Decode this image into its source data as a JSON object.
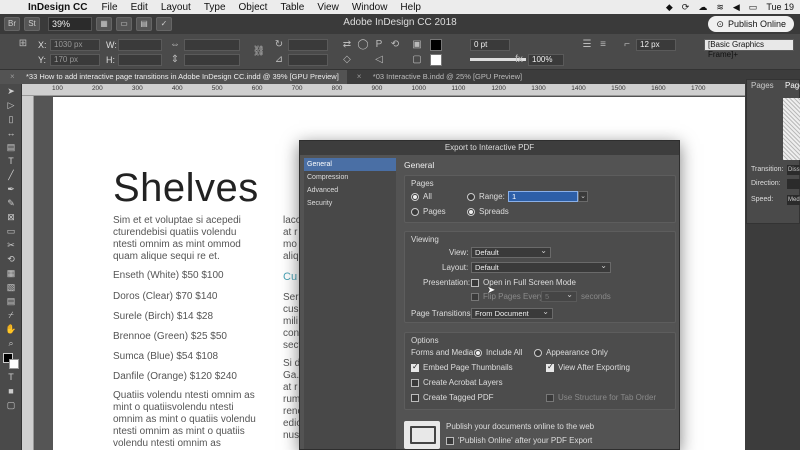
{
  "menubar": {
    "app": "InDesign CC",
    "menus": [
      "File",
      "Edit",
      "Layout",
      "Type",
      "Object",
      "Table",
      "View",
      "Window",
      "Help"
    ],
    "clock": "Tue 19"
  },
  "appbar": {
    "title": "Adobe InDesign CC 2018",
    "zoom": "39%",
    "br_label": "Br",
    "st_label": "St",
    "publish_label": "Publish Online"
  },
  "control": {
    "x_label": "X:",
    "y_label": "Y:",
    "w_label": "W:",
    "h_label": "H:",
    "x_value": "1030 px",
    "y_value": "170 px",
    "stroke_weight": "0 pt",
    "opacity": "100%",
    "size_value": "12 px",
    "style_value": "[Basic Graphics Frame]+"
  },
  "tabs": [
    {
      "label": "*33 How to add interactive page transitions in Adobe InDesign CC.indd @ 39% [GPU Preview]"
    },
    {
      "label": "*03 Interactive B.indd @ 25% [GPU Preview]"
    }
  ],
  "ruler": {
    "ticks": [
      "100",
      "200",
      "300",
      "400",
      "500",
      "600",
      "700",
      "800",
      "900",
      "1000",
      "1100",
      "1200",
      "1300",
      "1400",
      "1500",
      "1600",
      "1700"
    ]
  },
  "document": {
    "heading": "Shelves",
    "intro": "Sim et et voluptae si acepedi cturendebisi quatiis volendu ntesti omnim as mint ommod quam alique sequi re et.",
    "prices": [
      "Enseth (White) $50 $100",
      "Doros (Clear) $70 $140",
      "Surele (Birch) $14 $28",
      "Brennoe (Green) $25 $50",
      "Sumca (Blue) $54 $108",
      "Danfile (Orange) $120 $240"
    ],
    "outro": "Quatiis volendu ntesti omnim as mint o quatiisvolendu ntesti omnim as mint o quatiis volendu ntesti omnim as mint o quatiis volendu ntesti omnim as",
    "col2_top": [
      "laco",
      "at r",
      "mo",
      "aliq"
    ],
    "col2_heading": "Cu",
    "col2_mid": [
      "Sera",
      "cus",
      "mili",
      "con",
      "sect"
    ],
    "col2_bottom": [
      "Si d",
      "Ga.",
      "at r",
      "rum",
      "renc",
      "edio",
      "nus"
    ]
  },
  "panel": {
    "pages_tab": "Pages",
    "pages_tab2": "Page",
    "transition_label": "Transition:",
    "direction_label": "Direction:",
    "speed_label": "Speed:",
    "transition_value": "Diss",
    "speed_value": "Med"
  },
  "dialog": {
    "title": "Export to Interactive PDF",
    "sidebar": [
      "General",
      "Compression",
      "Advanced",
      "Security"
    ],
    "section": "General",
    "pages_group": "Pages",
    "all": "All",
    "range": "Range:",
    "range_value": "1",
    "pages_opt": "Pages",
    "spreads_opt": "Spreads",
    "viewing_group": "Viewing",
    "view_label": "View:",
    "view_value": "Default",
    "layout_label": "Layout:",
    "layout_value": "Default",
    "presentation_label": "Presentation:",
    "fullscreen": "Open in Full Screen Mode",
    "flip_label": "Flip Pages Every:",
    "flip_value": "5",
    "seconds": "seconds",
    "transitions_label": "Page Transitions:",
    "transitions_value": "From Document",
    "options_group": "Options",
    "forms_label": "Forms and Media:",
    "include_all": "Include All",
    "appearance_only": "Appearance Only",
    "embed_thumbs": "Embed Page Thumbnails",
    "view_after": "View After Exporting",
    "acrobat_layers": "Create Acrobat Layers",
    "tagged_pdf": "Create Tagged PDF",
    "structure_tab": "Use Structure for Tab Order",
    "publish_text": "Publish your documents online to the web",
    "publish_check": "'Publish Online' after your PDF Export"
  }
}
